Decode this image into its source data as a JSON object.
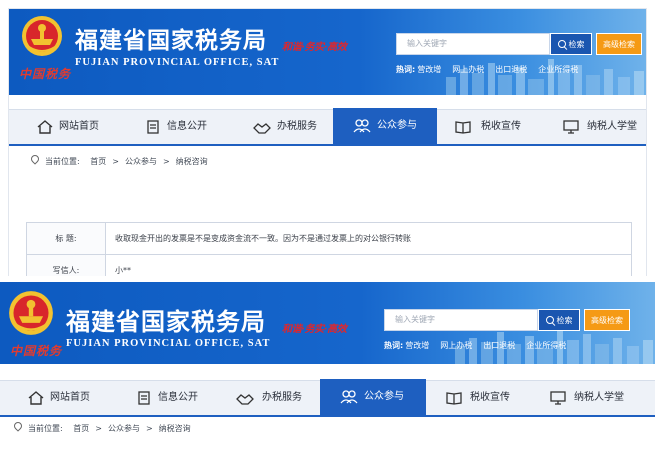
{
  "site": {
    "title_cn": "福建省国家税务局",
    "title_en": "FUJIAN PROVINCIAL OFFICE, SAT",
    "slogan": "和谐·务实·高效",
    "china_tax": "中国税务"
  },
  "search": {
    "placeholder": "输入关键字",
    "search_button": "检索",
    "advanced_button": "高级检索"
  },
  "hot": {
    "label": "热词:",
    "items": [
      "营改增",
      "网上办税",
      "出口退税",
      "企业所得税"
    ]
  },
  "nav": {
    "items": [
      "网站首页",
      "信息公开",
      "办税服务",
      "公众参与",
      "税收宣传",
      "纳税人学堂"
    ],
    "active_index": 3
  },
  "breadcrumb": {
    "label": "当前位置:",
    "items": [
      "首页",
      "公众参与",
      "纳税咨询"
    ]
  },
  "detail": {
    "title_label": "标    题:",
    "title_value": "收取现金开出的发票是不是变成资金流不一致。因为不是通过发票上的对公银行转账",
    "writer_label": "写信人:",
    "writer_value": "小**"
  },
  "colors": {
    "header_blue": "#1666cc",
    "nav_active": "#1e5fc0",
    "advanced_orange": "#f59a15",
    "slogan_red": "#e0262b"
  }
}
